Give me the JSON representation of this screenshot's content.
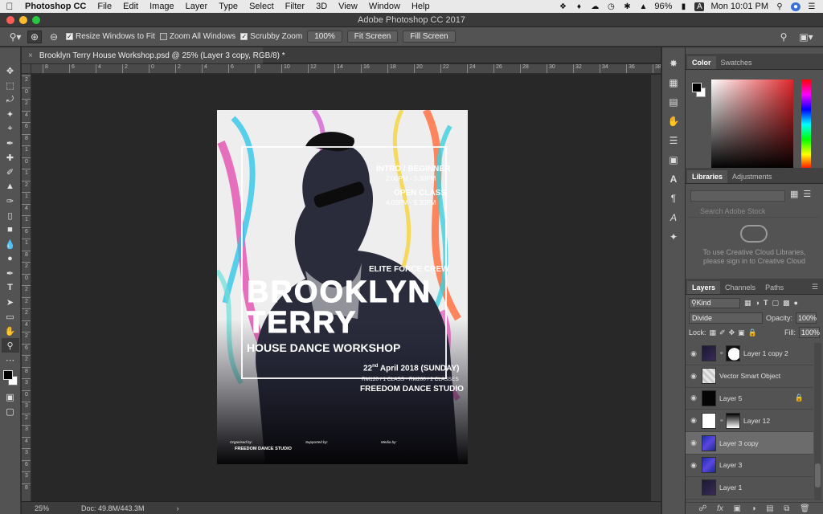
{
  "menubar": {
    "app": "Photoshop CC",
    "items": [
      "File",
      "Edit",
      "Image",
      "Layer",
      "Type",
      "Select",
      "Filter",
      "3D",
      "View",
      "Window",
      "Help"
    ],
    "battery": "96%",
    "clock": "Mon 10:01 PM"
  },
  "window": {
    "title": "Adobe Photoshop CC 2017"
  },
  "options": {
    "resize_windows": "Resize Windows to Fit",
    "zoom_all": "Zoom All Windows",
    "scrubby": "Scrubby Zoom",
    "zoom_value": "100%",
    "fit_screen": "Fit Screen",
    "fill_screen": "Fill Screen"
  },
  "document": {
    "tab_label": "Brooklyn Terry House Workshop.psd @ 25% (Layer 3 copy, RGB/8) *"
  },
  "rulers": {
    "top": [
      "8",
      "6",
      "4",
      "2",
      "0",
      "2",
      "4",
      "6",
      "8",
      "10",
      "12",
      "14",
      "16",
      "18",
      "20",
      "22",
      "24",
      "26",
      "28",
      "30",
      "32",
      "34",
      "36",
      "38"
    ],
    "left": [
      "2",
      "0",
      "2",
      "4",
      "6",
      "8",
      "1",
      "0",
      "1",
      "2",
      "1",
      "4",
      "1",
      "6",
      "1",
      "8",
      "2",
      "0",
      "2",
      "2",
      "2",
      "4",
      "2",
      "6",
      "2",
      "8",
      "3",
      "0",
      "3",
      "2",
      "3",
      "4",
      "3",
      "6",
      "3",
      "8"
    ]
  },
  "poster": {
    "intro": "INTRO / BEGINNER",
    "intro_time": "2.00PM - 3.30PM",
    "open": "OPEN CLASS",
    "open_time": "4.00PM - 5.30PM",
    "crew": "ELITE FORCE CREW",
    "title1": "BROOKLYN",
    "title2": "TERRY",
    "subtitle": "HOUSE DANCE WORKSHOP",
    "date_day": "22",
    "date_sup": "nd",
    "date_rest": "April 2018 (SUNDAY)",
    "price": "RM120 / 1 CLASS  ·  RM200 / 2 CLASSES",
    "studio": "FREEDOM DANCE STUDIO",
    "organised": "Organised by:",
    "supported": "Supported by:",
    "media": "Media by:",
    "org_logo": "FREEDOM DANCE STUDIO"
  },
  "status": {
    "zoom": "25%",
    "doc": "Doc: 49.8M/443.3M"
  },
  "color_panel": {
    "tabs": [
      "Color",
      "Swatches"
    ]
  },
  "library_panel": {
    "tabs": [
      "Libraries",
      "Adjustments"
    ],
    "search_placeholder": "Search Adobe Stock",
    "message_line1": "To use Creative Cloud Libraries,",
    "message_line2": "please sign in to Creative Cloud"
  },
  "layers_panel": {
    "tabs": [
      "Layers",
      "Channels",
      "Paths"
    ],
    "kind": "Kind",
    "blend_mode": "Divide",
    "opacity_label": "Opacity:",
    "opacity": "100%",
    "lock_label": "Lock:",
    "fill_label": "Fill:",
    "fill": "100%",
    "layers": [
      {
        "name": "Layer 1 copy 2",
        "thumb": "dark",
        "mask": "white-shape",
        "selected": false,
        "visible": true,
        "locked": false
      },
      {
        "name": "Vector Smart Object",
        "thumb": "light",
        "mask": "",
        "selected": false,
        "visible": true,
        "locked": false
      },
      {
        "name": "Layer 5",
        "thumb": "black",
        "mask": "",
        "selected": false,
        "visible": true,
        "locked": true
      },
      {
        "name": "Layer 12",
        "thumb": "white",
        "mask": "gradient",
        "selected": false,
        "visible": true,
        "locked": false
      },
      {
        "name": "Layer 3 copy",
        "thumb": "blue",
        "mask": "",
        "selected": true,
        "visible": true,
        "locked": false
      },
      {
        "name": "Layer 3",
        "thumb": "blue",
        "mask": "",
        "selected": false,
        "visible": true,
        "locked": false
      },
      {
        "name": "Layer 1",
        "thumb": "dark",
        "mask": "",
        "selected": false,
        "visible": false,
        "locked": false
      }
    ]
  },
  "colors": {
    "accent_red": "#e1272b",
    "panel_bg": "#535353",
    "canvas_bg": "#282828"
  }
}
